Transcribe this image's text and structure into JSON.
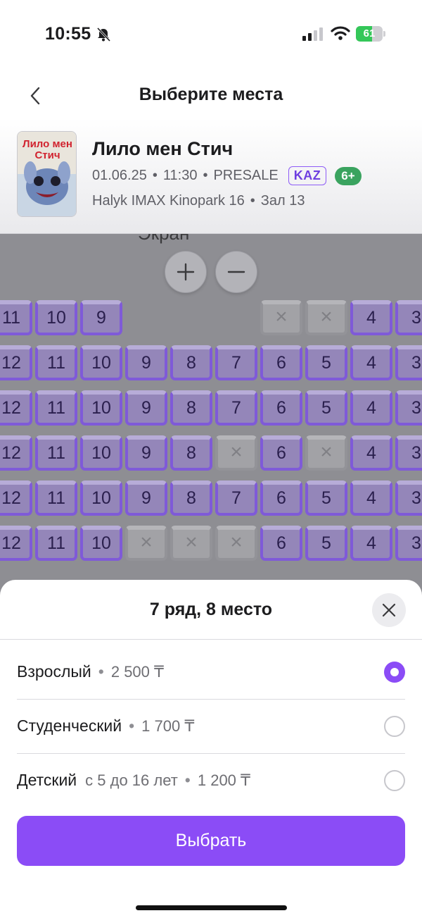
{
  "status_bar": {
    "time": "10:55",
    "battery": "61",
    "battery_level": 0.61
  },
  "header": {
    "title": "Выберите места"
  },
  "movie": {
    "title": "Лило мен Стич",
    "date": "01.06.25",
    "time": "11:30",
    "sale_status": "PRESALE",
    "language": "KAZ",
    "age_rating": "6+",
    "cinema": "Halyk IMAX Kinopark 16",
    "hall": "Зал 13",
    "poster_text": "Лило мен Стич"
  },
  "seatmap": {
    "screen_label": "Экран",
    "zoom_in": "+",
    "zoom_out": "−",
    "rows": [
      {
        "seats": [
          [
            "11",
            "free"
          ],
          [
            "10",
            "free"
          ],
          [
            "9",
            "free"
          ],
          [
            "",
            "gap"
          ],
          [
            "",
            "gap"
          ],
          [
            "",
            "gap"
          ],
          [
            "",
            "taken"
          ],
          [
            "",
            "taken"
          ],
          [
            "4",
            "free"
          ],
          [
            "3",
            "free"
          ]
        ]
      },
      {
        "seats": [
          [
            "12",
            "free"
          ],
          [
            "11",
            "free"
          ],
          [
            "10",
            "free"
          ],
          [
            "9",
            "free"
          ],
          [
            "8",
            "free"
          ],
          [
            "7",
            "free"
          ],
          [
            "6",
            "free"
          ],
          [
            "5",
            "free"
          ],
          [
            "4",
            "free"
          ],
          [
            "3",
            "free"
          ]
        ]
      },
      {
        "seats": [
          [
            "12",
            "free"
          ],
          [
            "11",
            "free"
          ],
          [
            "10",
            "free"
          ],
          [
            "9",
            "free"
          ],
          [
            "8",
            "free"
          ],
          [
            "7",
            "free"
          ],
          [
            "6",
            "free"
          ],
          [
            "5",
            "free"
          ],
          [
            "4",
            "free"
          ],
          [
            "3",
            "free"
          ]
        ]
      },
      {
        "seats": [
          [
            "12",
            "free"
          ],
          [
            "11",
            "free"
          ],
          [
            "10",
            "free"
          ],
          [
            "9",
            "free"
          ],
          [
            "8",
            "free"
          ],
          [
            "",
            "taken"
          ],
          [
            "6",
            "free"
          ],
          [
            "",
            "taken"
          ],
          [
            "4",
            "free"
          ],
          [
            "3",
            "free"
          ]
        ]
      },
      {
        "seats": [
          [
            "12",
            "free"
          ],
          [
            "11",
            "free"
          ],
          [
            "10",
            "free"
          ],
          [
            "9",
            "free"
          ],
          [
            "8",
            "free"
          ],
          [
            "7",
            "free"
          ],
          [
            "6",
            "free"
          ],
          [
            "5",
            "free"
          ],
          [
            "4",
            "free"
          ],
          [
            "3",
            "free"
          ]
        ]
      },
      {
        "seats": [
          [
            "12",
            "free"
          ],
          [
            "11",
            "free"
          ],
          [
            "10",
            "free"
          ],
          [
            "",
            "taken"
          ],
          [
            "",
            "taken"
          ],
          [
            "",
            "taken"
          ],
          [
            "6",
            "free"
          ],
          [
            "5",
            "free"
          ],
          [
            "4",
            "free"
          ],
          [
            "3",
            "free"
          ]
        ]
      }
    ]
  },
  "sheet": {
    "title": "7 ряд, 8 место",
    "tickets": [
      {
        "name": "Взрослый",
        "note": "",
        "price": "2 500 ₸",
        "selected": true
      },
      {
        "name": "Студенческий",
        "note": "",
        "price": "1 700 ₸",
        "selected": false
      },
      {
        "name": "Детский",
        "note": "с 5 до 16 лет",
        "price": "1 200 ₸",
        "selected": false
      }
    ],
    "select_label": "Выбрать"
  },
  "colors": {
    "accent": "#8b4cf6",
    "seat_free": "#7f5ad8",
    "seat_taken": "#a2a2a6",
    "age_badge": "#3aa35f"
  }
}
